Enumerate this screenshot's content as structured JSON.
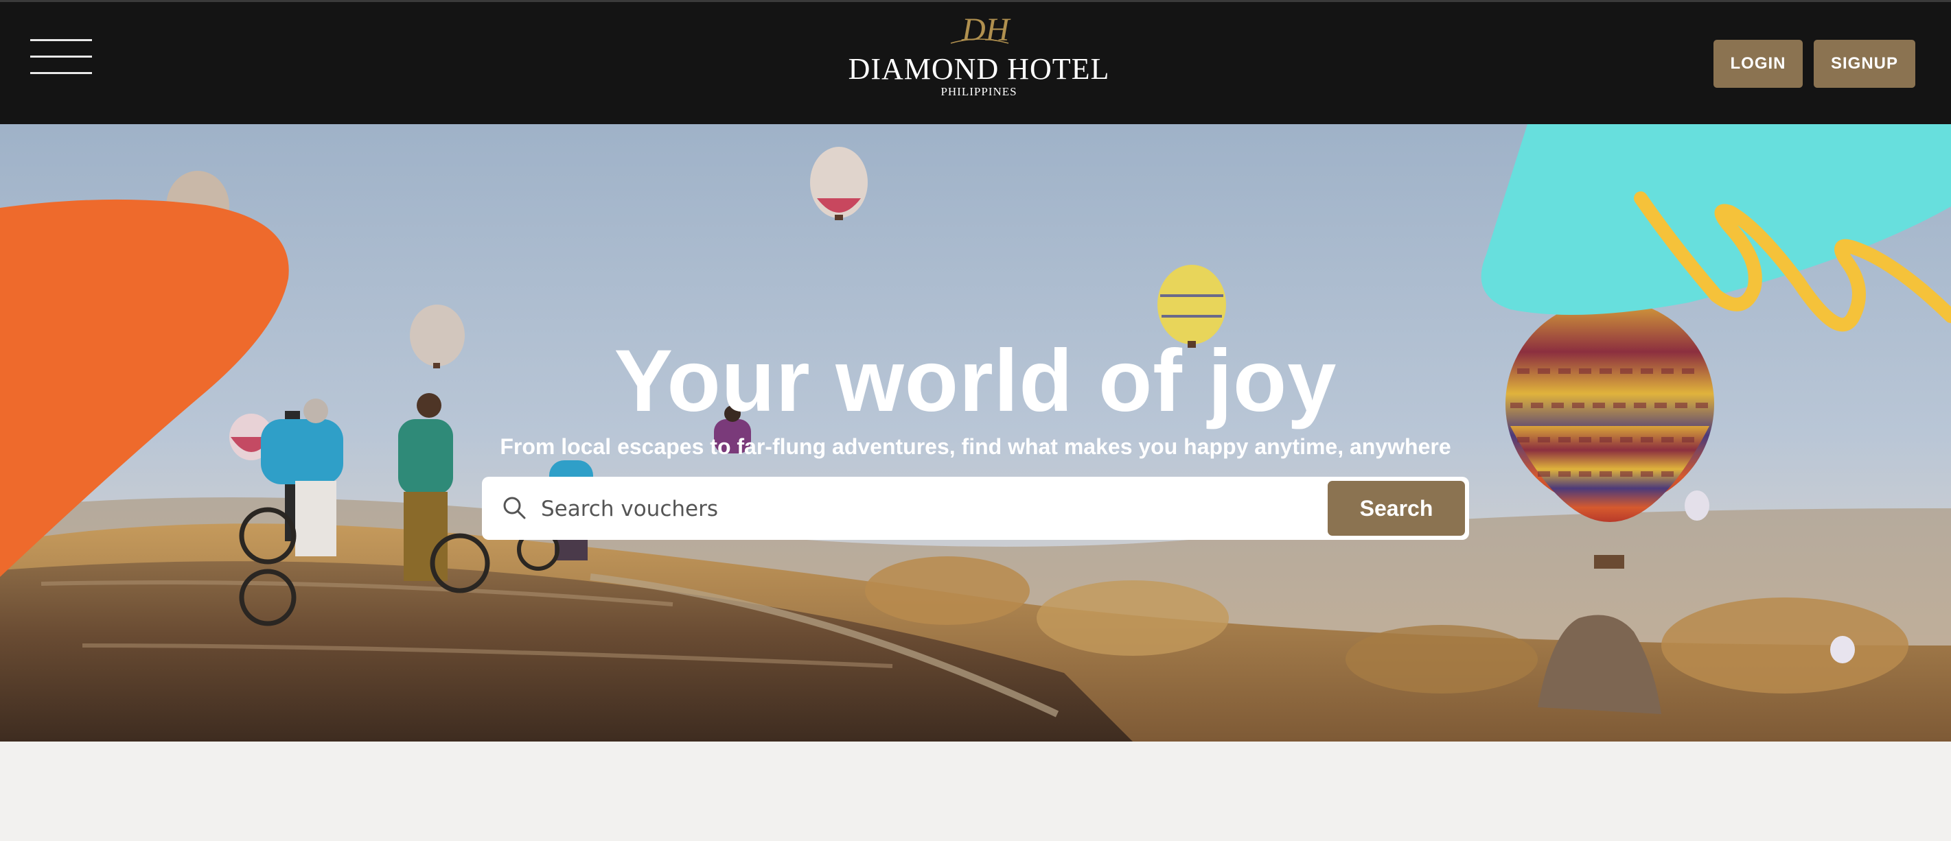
{
  "header": {
    "menu_icon": "hamburger-menu-icon",
    "logo": {
      "monogram": "DH",
      "name": "DIAMOND HOTEL",
      "subtitle": "PHILIPPINES"
    },
    "login_label": "LOGIN",
    "signup_label": "SIGNUP"
  },
  "hero": {
    "headline": "Your world of joy",
    "subheadline": "From local escapes to far-flung adventures, find what makes you happy anytime, anywhere",
    "search": {
      "icon": "search-icon",
      "placeholder": "Search vouchers",
      "value": "",
      "button_label": "Search"
    }
  },
  "colors": {
    "header_bg": "#141414",
    "accent_brown": "#8b7351",
    "shape_orange": "#ee6a2c",
    "shape_cyan": "#67dfdd",
    "squiggle_yellow": "#f5c23a",
    "page_bg": "#f2f1ef"
  }
}
